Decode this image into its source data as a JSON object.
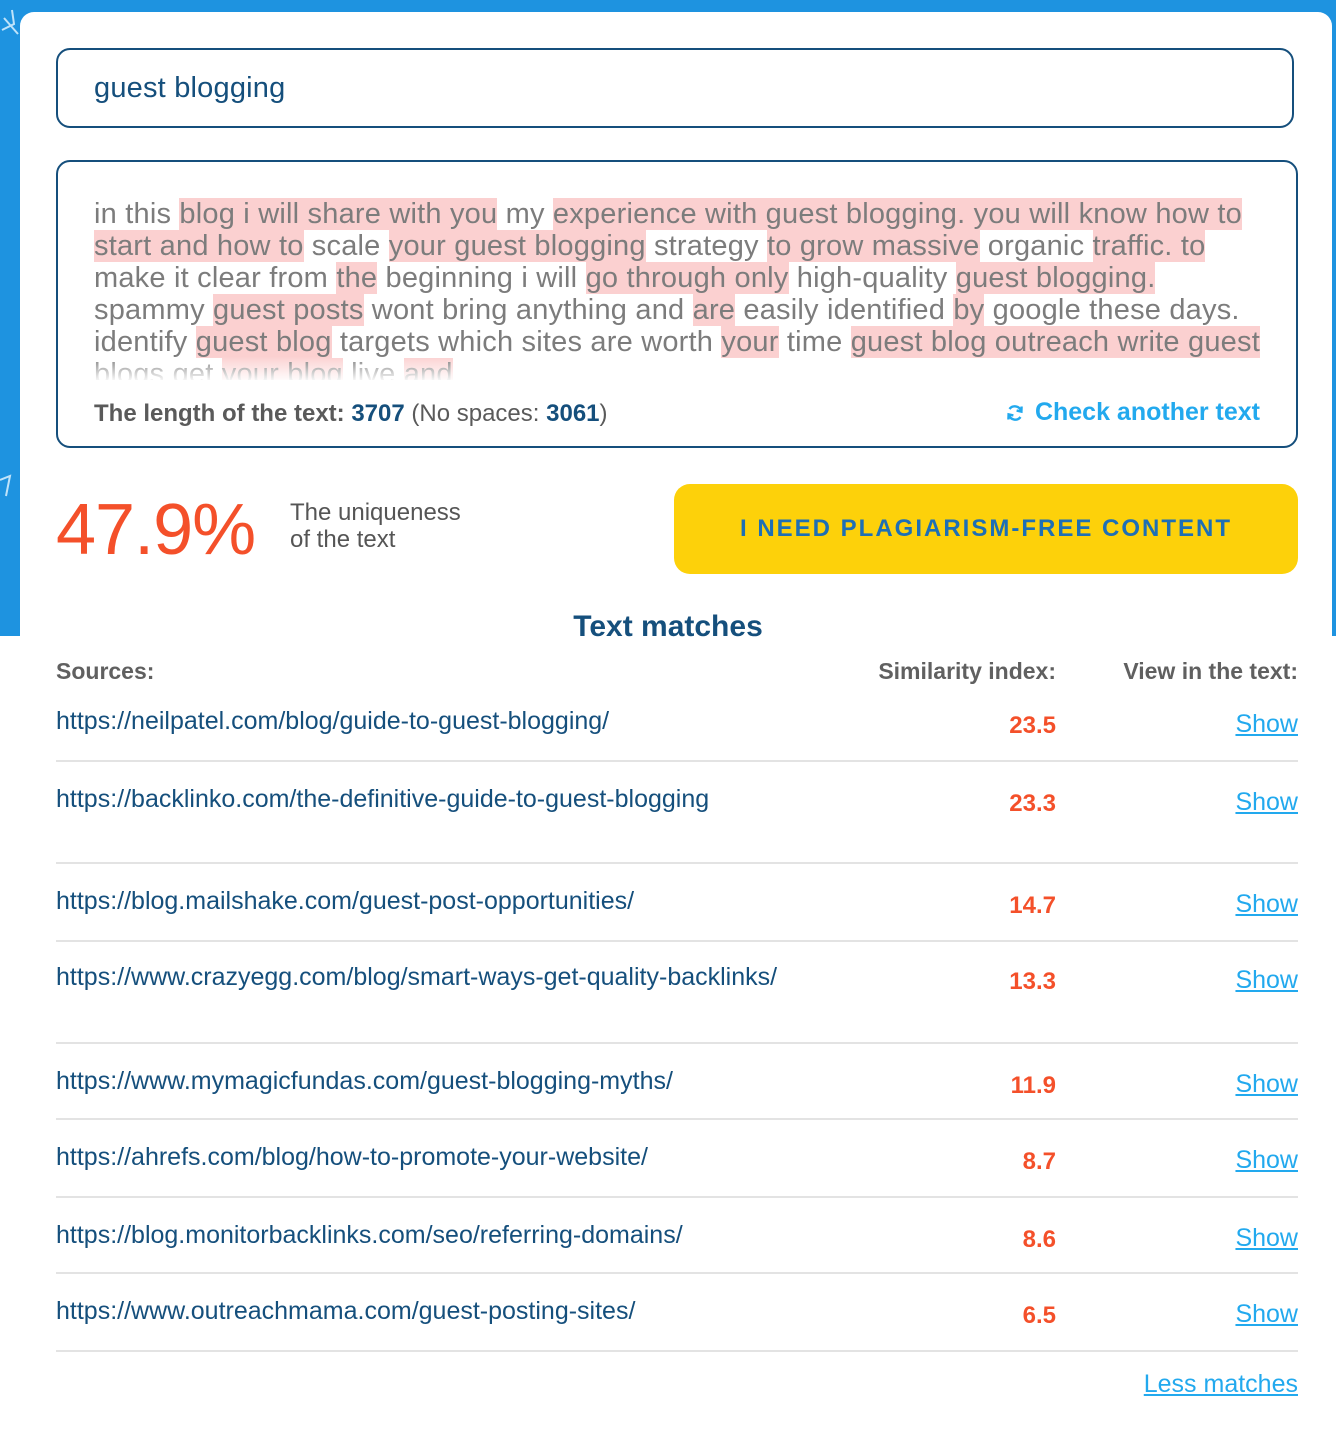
{
  "keyword_input": {
    "value": "guest blogging"
  },
  "text_segments": [
    {
      "t": "in this ",
      "h": false
    },
    {
      "t": "blog i will share with you",
      "h": true
    },
    {
      "t": " my ",
      "h": false
    },
    {
      "t": "experience with guest blogging. you will know how to start and how to",
      "h": true
    },
    {
      "t": " scale ",
      "h": false
    },
    {
      "t": "your guest blogging",
      "h": true
    },
    {
      "t": " strategy ",
      "h": false
    },
    {
      "t": "to grow massive",
      "h": true
    },
    {
      "t": " organic ",
      "h": false
    },
    {
      "t": "traffic. to",
      "h": true
    },
    {
      "t": " make it clear from ",
      "h": false
    },
    {
      "t": "the",
      "h": true
    },
    {
      "t": " beginning i will ",
      "h": false
    },
    {
      "t": "go through only",
      "h": true
    },
    {
      "t": " high-quality ",
      "h": false
    },
    {
      "t": "guest blogging.",
      "h": true
    },
    {
      "t": " spammy ",
      "h": false
    },
    {
      "t": "guest posts",
      "h": true
    },
    {
      "t": " wont bring anything and ",
      "h": false
    },
    {
      "t": "are",
      "h": true
    },
    {
      "t": " easily identified ",
      "h": false
    },
    {
      "t": "by",
      "h": true
    },
    {
      "t": " google these days. identify ",
      "h": false
    },
    {
      "t": "guest blog",
      "h": true
    },
    {
      "t": " targets which sites are worth ",
      "h": false
    },
    {
      "t": "your",
      "h": true
    },
    {
      "t": " time ",
      "h": false
    },
    {
      "t": "guest blog outreach write guest",
      "h": true
    },
    {
      "t": " blogs get ",
      "h": false
    },
    {
      "t": "your blog",
      "h": true
    },
    {
      "t": " live ",
      "h": false
    },
    {
      "t": "and",
      "h": true
    }
  ],
  "stats": {
    "length_label": "The length of the text:",
    "length_value": "3707",
    "no_spaces_open": "(No spaces:",
    "no_spaces_value": "3061",
    "no_spaces_close": ")",
    "check_another": "Check another text"
  },
  "uniqueness": {
    "value": "47.9%",
    "label_line1": "The uniqueness",
    "label_line2": "of the text"
  },
  "cta_label": "I NEED PLAGIARISM-FREE CONTENT",
  "matches": {
    "title": "Text matches",
    "col_sources": "Sources:",
    "col_similarity": "Similarity index:",
    "col_view": "View in the text:",
    "show_label": "Show",
    "less_label": "Less matches",
    "rows": [
      {
        "url": "https://neilpatel.com/blog/guide-to-guest-blogging/",
        "score": "23.5"
      },
      {
        "url": "https://backlinko.com/the-definitive-guide-to-guest-blogging",
        "score": "23.3"
      },
      {
        "url": "https://blog.mailshake.com/guest-post-opportunities/",
        "score": "14.7"
      },
      {
        "url": "https://www.crazyegg.com/blog/smart-ways-get-quality-backlinks/",
        "score": "13.3"
      },
      {
        "url": "https://www.mymagicfundas.com/guest-blogging-myths/",
        "score": "11.9"
      },
      {
        "url": "https://ahrefs.com/blog/how-to-promote-your-website/",
        "score": "8.7"
      },
      {
        "url": "https://blog.monitorbacklinks.com/seo/referring-domains/",
        "score": "8.6"
      },
      {
        "url": "https://www.outreachmama.com/guest-posting-sites/",
        "score": "6.5"
      }
    ]
  },
  "colors": {
    "brand_blue": "#154f7c",
    "background_blue": "#1e93e0",
    "link_blue": "#22a9ee",
    "accent_orange": "#f4502a",
    "cta_yellow": "#fdd10a",
    "highlight_pink": "#fbd0d0"
  }
}
